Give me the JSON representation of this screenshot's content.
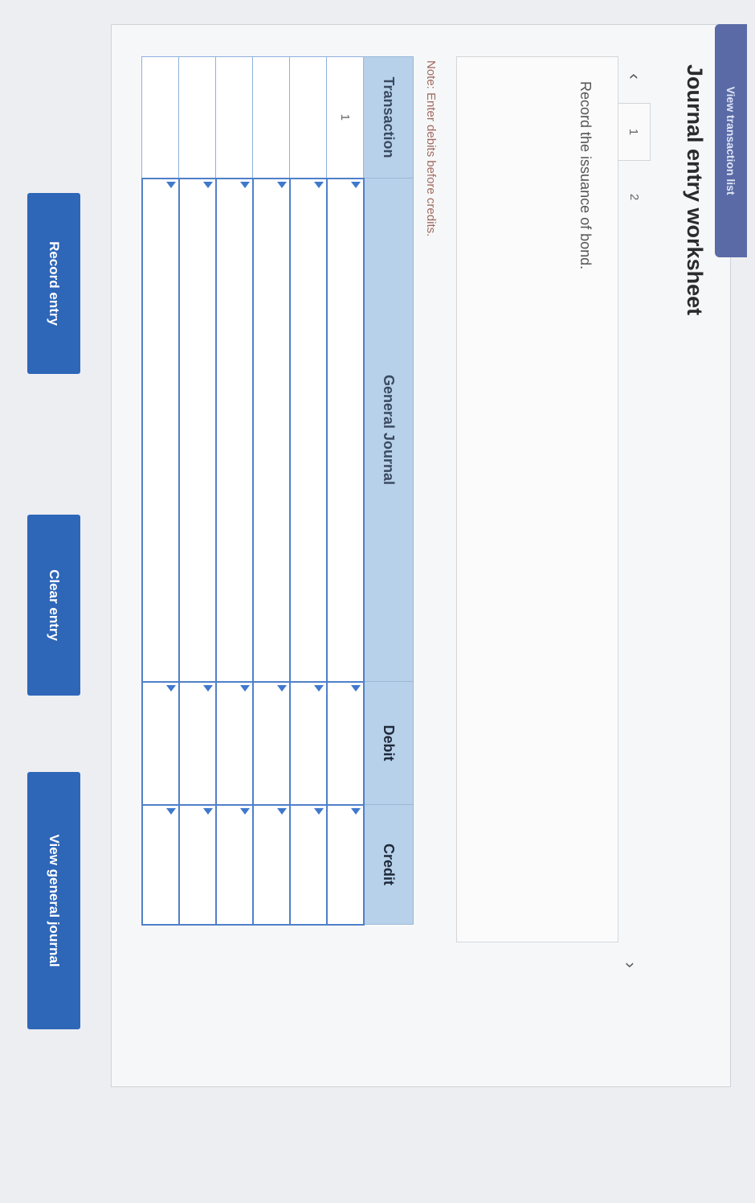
{
  "header": {
    "tab_label": "View transaction list"
  },
  "worksheet": {
    "title": "Journal entry worksheet",
    "tabs": [
      {
        "label": "1"
      },
      {
        "label": "2"
      }
    ],
    "instruction": "Record the issuance of bond.",
    "note": "Note: Enter debits before credits."
  },
  "table": {
    "headers": {
      "transaction": "Transaction",
      "general_journal": "General Journal",
      "debit": "Debit",
      "credit": "Credit"
    },
    "rows": [
      {
        "transaction": "1",
        "account": "",
        "debit": "",
        "credit": ""
      },
      {
        "transaction": "",
        "account": "",
        "debit": "",
        "credit": ""
      },
      {
        "transaction": "",
        "account": "",
        "debit": "",
        "credit": ""
      },
      {
        "transaction": "",
        "account": "",
        "debit": "",
        "credit": ""
      },
      {
        "transaction": "",
        "account": "",
        "debit": "",
        "credit": ""
      },
      {
        "transaction": "",
        "account": "",
        "debit": "",
        "credit": ""
      }
    ]
  },
  "buttons": {
    "record": "Record entry",
    "clear": "Clear entry",
    "view": "View general journal"
  },
  "colors": {
    "accent": "#2e66b8",
    "header_bg": "#b8d1ea",
    "note": "#a06b5f"
  },
  "icons": {
    "prev": "chevron-left-icon",
    "next": "chevron-right-icon",
    "input_marker": "triangle-marker-icon"
  }
}
